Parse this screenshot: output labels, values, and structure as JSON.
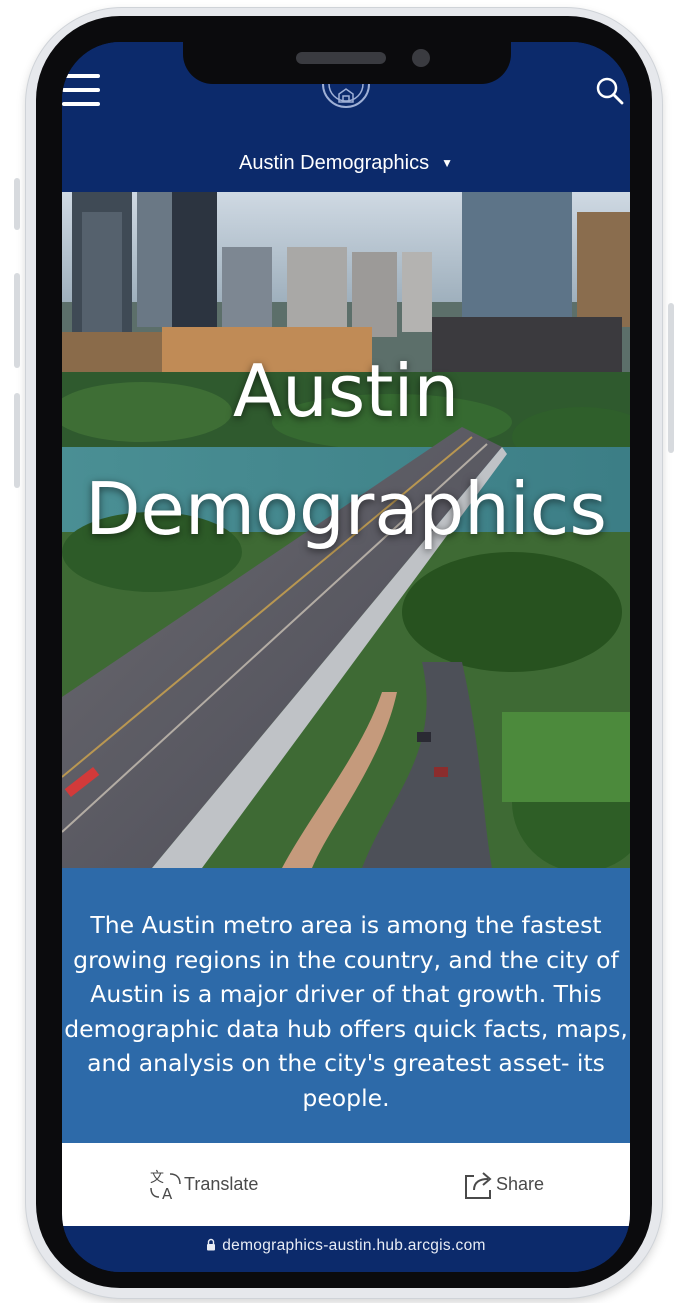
{
  "nav": {
    "menu_icon": "hamburger-menu-icon",
    "logo_icon": "city-seal-icon",
    "search_icon": "search-icon"
  },
  "site_selector": {
    "label": "Austin Demographics",
    "caret": "▼"
  },
  "hero": {
    "title_line1": "Austin",
    "title_line2": "Demographics",
    "image": "aerial photo of Austin skyline, river and bridge"
  },
  "intro": {
    "text": "The Austin metro area is among the fastest growing regions in the country, and the city of Austin is a major driver of that growth. This demographic data hub offers quick facts, maps, and analysis on the city's greatest asset- its people."
  },
  "actions": {
    "translate_label": "Translate",
    "translate_icon": "translate-icon",
    "share_label": "Share",
    "share_icon": "share-icon"
  },
  "browser": {
    "url": "demographics-austin.hub.arcgis.com",
    "lock_icon": "lock-icon"
  },
  "colors": {
    "header_navy": "#0c2a6b",
    "intro_blue": "#2d6aa9",
    "white": "#ffffff"
  }
}
